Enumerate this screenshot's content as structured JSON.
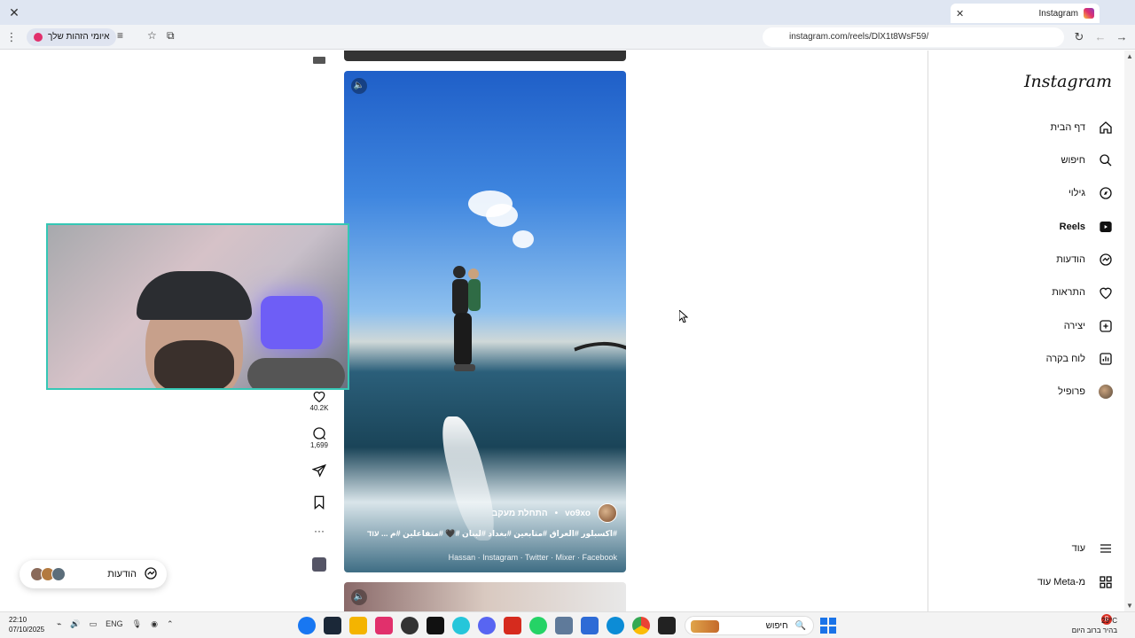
{
  "browser": {
    "tab_title": "Instagram",
    "url": "instagram.com/reels/DlX1t8WsF59/",
    "extension_pill_label": "איומי הזהות שלך",
    "colors": {
      "accent": "#e1306c",
      "titlebar": "#dfe6f2"
    }
  },
  "sidebar": {
    "logo": "Instagram",
    "items": [
      {
        "label": "דף הבית",
        "icon": "home-icon"
      },
      {
        "label": "חיפוש",
        "icon": "search-icon"
      },
      {
        "label": "גילוי",
        "icon": "compass-icon"
      },
      {
        "label": "Reels",
        "icon": "reels-icon",
        "active": true
      },
      {
        "label": "הודעות",
        "icon": "messenger-icon"
      },
      {
        "label": "התראות",
        "icon": "heart-icon"
      },
      {
        "label": "יצירה",
        "icon": "plus-square-icon"
      },
      {
        "label": "לוח בקרה",
        "icon": "dashboard-icon"
      },
      {
        "label": "פרופיל",
        "icon": "avatar-icon"
      }
    ],
    "bottom": [
      {
        "label": "עוד",
        "icon": "menu-icon"
      },
      {
        "label": "עוד Meta-מ",
        "icon": "apps-icon"
      }
    ]
  },
  "reel": {
    "username": "vo9xo",
    "follow_label": "התחלת מעקב",
    "caption": "#اكسبلور #العراق #متابعين #بغداد #لبنان #🖤 #متفاعلين #م ... עוד",
    "audio": "Hassan · Instagram · Twitter · Mixer · Facebook",
    "likes": "40.2K",
    "comments": "1,699"
  },
  "messages_pill": {
    "label": "הודעות"
  },
  "taskbar": {
    "time": "22:10",
    "date": "07/10/2025",
    "lang": "ENG",
    "search_placeholder": "חיפוש",
    "weather_temp": "29°C",
    "weather_desc": "בהיר ברוב היום",
    "notification_count": "8"
  }
}
